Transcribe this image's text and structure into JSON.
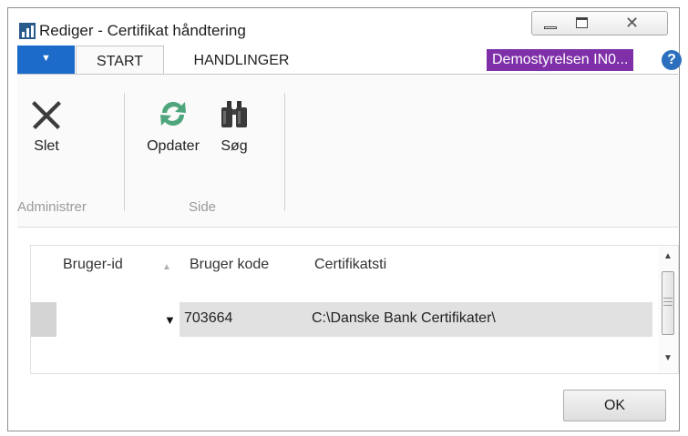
{
  "window": {
    "title": "Rediger - Certifikat håndtering",
    "icons": {
      "app": "chart-bars-icon",
      "minimize": "minimize-icon",
      "maximize": "maximize-icon",
      "close": "close-icon"
    }
  },
  "ribbon": {
    "file_tab_glyph": "▼",
    "tabs": [
      {
        "label": "START",
        "active": true
      },
      {
        "label": "HANDLINGER",
        "active": false
      }
    ],
    "company_badge": "Demostyrelsen IN0...",
    "company_color": "#7f2fa8",
    "help_glyph": "?",
    "groups": [
      {
        "label": "Administrer",
        "buttons": [
          {
            "label": "Slet",
            "icon": "delete-x-icon"
          }
        ]
      },
      {
        "label": "Side",
        "buttons": [
          {
            "label": "Opdater",
            "icon": "refresh-icon"
          },
          {
            "label": "Søg",
            "icon": "binoculars-icon"
          }
        ]
      }
    ]
  },
  "grid": {
    "columns": [
      "Bruger-id",
      "Bruger kode",
      "Certifikatsti"
    ],
    "rows": [
      {
        "bruger_id": "",
        "bruger_kode": "703664",
        "certifikatsti": "C:\\Danske Bank Certifikater\\"
      }
    ]
  },
  "footer": {
    "ok_label": "OK"
  }
}
